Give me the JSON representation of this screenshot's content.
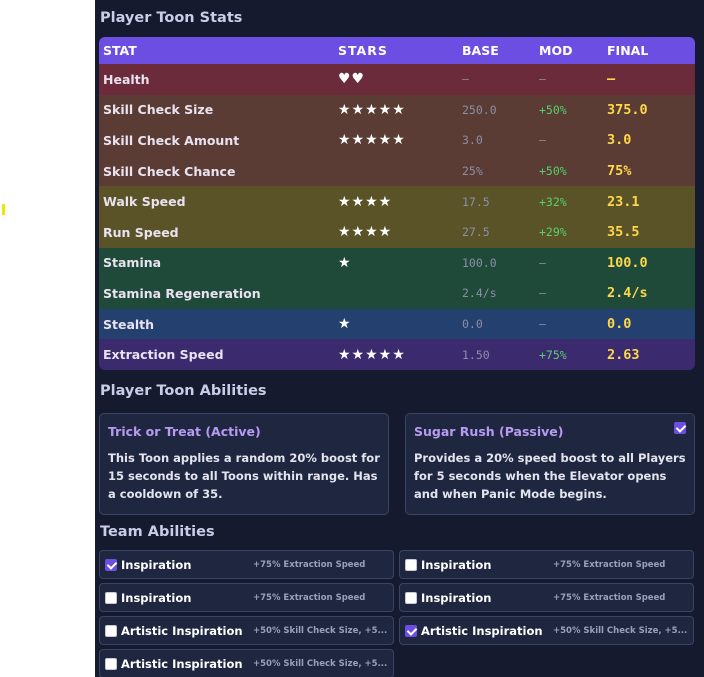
{
  "stats": {
    "title": "Player Toon Stats",
    "headers": {
      "stat": "STAT",
      "stars": "STARS",
      "base": "BASE",
      "mod": "MOD",
      "final": "FINAL"
    },
    "rows": [
      {
        "stat": "Health",
        "stars": "♥♥",
        "base": "–",
        "mod": "–",
        "final": "–"
      },
      {
        "stat": "Skill Check Size",
        "stars": "★★★★★",
        "base": "250.0",
        "mod": "+50%",
        "final": "375.0"
      },
      {
        "stat": "Skill Check Amount",
        "stars": "★★★★★",
        "base": "3.0",
        "mod": "–",
        "final": "3.0"
      },
      {
        "stat": "Skill Check Chance",
        "stars": "",
        "base": "25%",
        "mod": "+50%",
        "final": "75%"
      },
      {
        "stat": "Walk Speed",
        "stars": "★★★★",
        "base": "17.5",
        "mod": "+32%",
        "final": "23.1"
      },
      {
        "stat": "Run Speed",
        "stars": "★★★★",
        "base": "27.5",
        "mod": "+29%",
        "final": "35.5"
      },
      {
        "stat": "Stamina",
        "stars": "★",
        "base": "100.0",
        "mod": "–",
        "final": "100.0"
      },
      {
        "stat": "Stamina Regeneration",
        "stars": "",
        "base": "2.4/s",
        "mod": "–",
        "final": "2.4/s"
      },
      {
        "stat": "Stealth",
        "stars": "★",
        "base": "0.0",
        "mod": "–",
        "final": "0.0"
      },
      {
        "stat": "Extraction Speed",
        "stars": "★★★★★",
        "base": "1.50",
        "mod": "+75%",
        "final": "2.63"
      }
    ]
  },
  "abilities": {
    "title": "Player Toon Abilities",
    "active": {
      "name": "Trick or Treat (Active)",
      "description": "This Toon applies a random 20% boost for 15 seconds to all Toons within range. Has a cooldown of 35."
    },
    "passive": {
      "name": "Sugar Rush (Passive)",
      "description": "Provides a 20% speed boost to all Players for 5 seconds when the Elevator opens and when Panic Mode begins.",
      "checked": true
    }
  },
  "team": {
    "title": "Team Abilities",
    "items": [
      {
        "name": "Inspiration",
        "effect": "+75% Extraction Speed",
        "checked": true
      },
      {
        "name": "Inspiration",
        "effect": "+75% Extraction Speed",
        "checked": false
      },
      {
        "name": "Inspiration",
        "effect": "+75% Extraction Speed",
        "checked": false
      },
      {
        "name": "Inspiration",
        "effect": "+75% Extraction Speed",
        "checked": false
      },
      {
        "name": "Artistic Inspiration",
        "effect": "+50% Skill Check Size, +5...",
        "checked": false
      },
      {
        "name": "Artistic Inspiration",
        "effect": "+50% Skill Check Size, +5...",
        "checked": true
      },
      {
        "name": "Artistic Inspiration",
        "effect": "+50% Skill Check Size, +5...",
        "checked": false
      }
    ]
  },
  "colors": {
    "accent": "#6c4fe2",
    "final_value": "#ffd84a",
    "mod_positive": "#57d16a",
    "panel_bg": "#161a2e"
  }
}
